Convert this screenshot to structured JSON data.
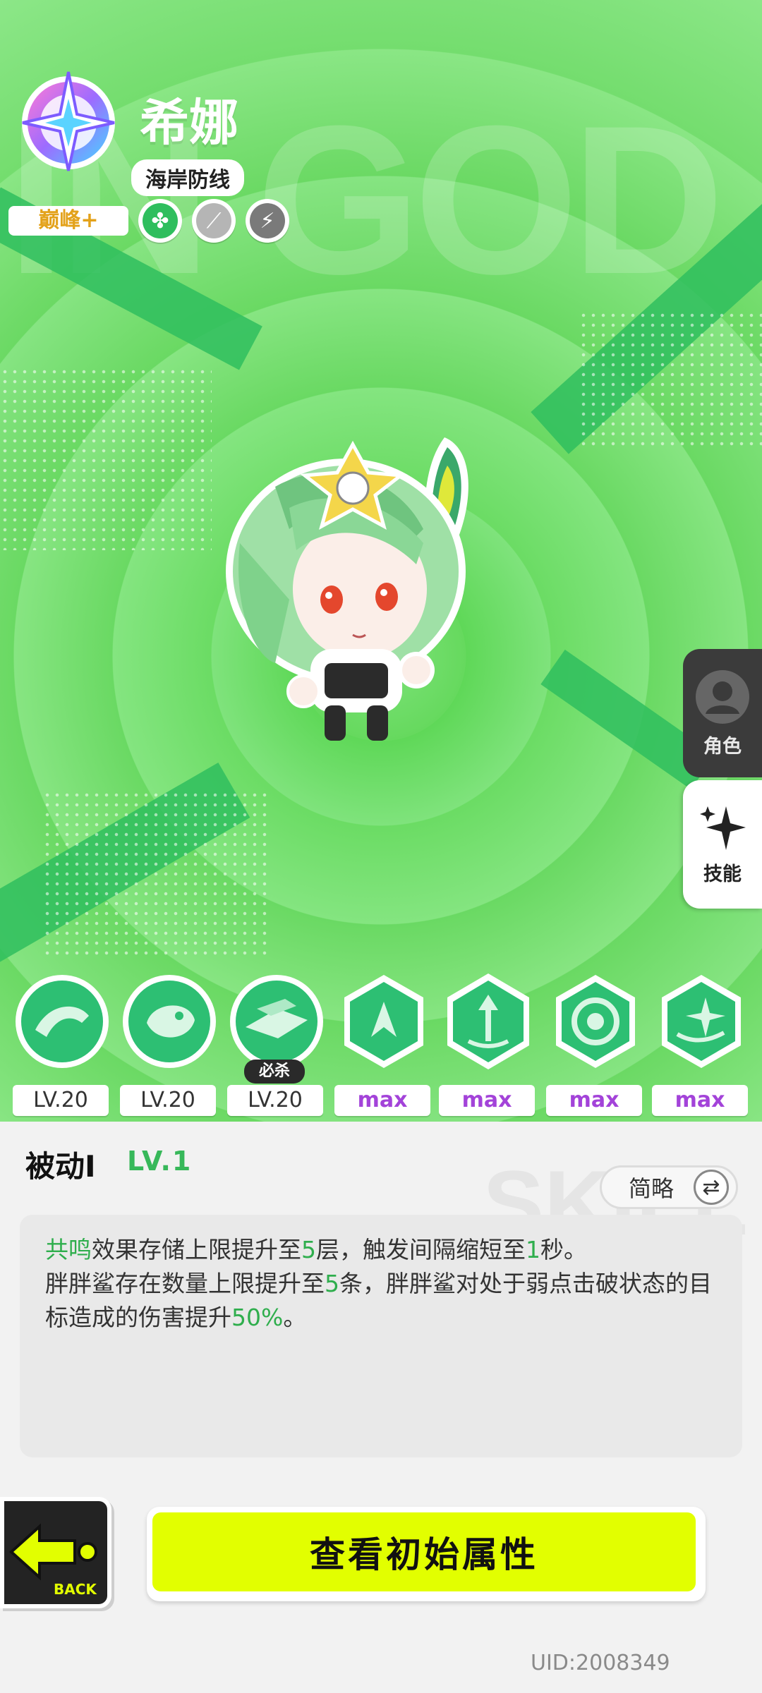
{
  "character": {
    "name": "希娜",
    "faction": "海岸防线",
    "rank": "巅峰+",
    "bg_text": "IN GOD",
    "elements": [
      {
        "icon": "clover-icon",
        "color": "#2fbe5e"
      },
      {
        "icon": "sword-icon",
        "color": "#b5b5b5"
      },
      {
        "icon": "crest-icon",
        "color": "#7a7a7a"
      }
    ]
  },
  "side_tabs": {
    "character_label": "角色",
    "skills_label": "技能"
  },
  "skills": {
    "items": [
      {
        "icon": "shark-leap-skill-icon",
        "level": "LV.20"
      },
      {
        "icon": "shark-bite-skill-icon",
        "level": "LV.20"
      },
      {
        "icon": "shark-swarm-skill-icon",
        "level": "LV.20"
      },
      {
        "icon": "arrow-burst-skill-icon",
        "level": "max"
      },
      {
        "icon": "tri-arrow-skill-icon",
        "level": "max"
      },
      {
        "icon": "swirl-skill-icon",
        "level": "max"
      },
      {
        "icon": "star-swirl-skill-icon",
        "level": "max"
      }
    ],
    "ultimate_tag": "必杀"
  },
  "detail": {
    "title": "被动I",
    "level": "LV.1",
    "bg_text": "SKILL",
    "toggle_label": "简略",
    "line1": {
      "p1": "共鸣",
      "p2": "效果存储上限提升至",
      "p3": "5",
      "p4": "层，触发间隔缩短至",
      "p5": "1",
      "p6": "秒。"
    },
    "line2": {
      "p1": "胖胖鲨存在数量上限提升至",
      "p2": "5",
      "p3": "条，胖胖鲨对处于弱点击破状态的目标造成的伤害提升",
      "p4": "50%",
      "p5": "。"
    }
  },
  "footer": {
    "back_label": "BACK",
    "primary_label": "查看初始属性",
    "uid": "UID:2008349"
  },
  "colors": {
    "accent_green": "#2fae4d",
    "max_purple": "#a343d9",
    "primary_yellow": "#e2ff00"
  }
}
